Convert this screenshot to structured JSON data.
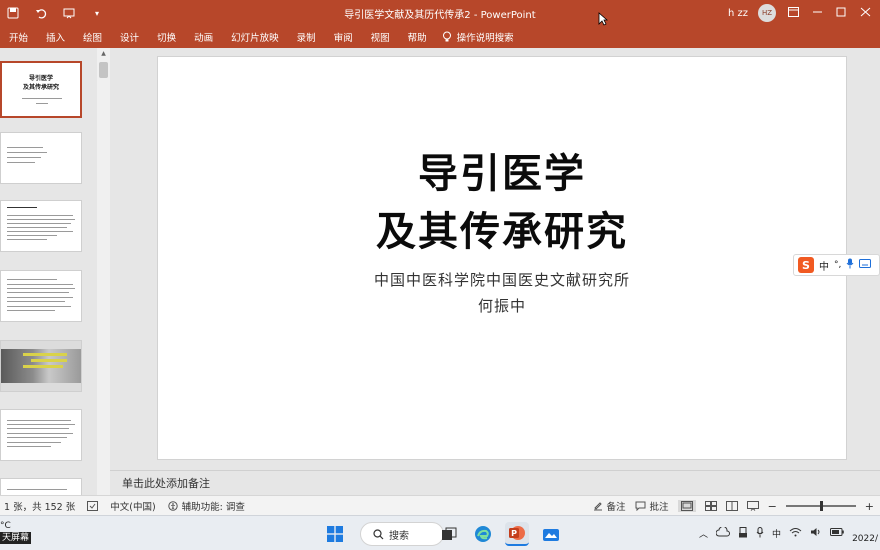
{
  "window": {
    "title": "导引医学文献及其历代传承2  -  PowerPoint",
    "user_name": "h zz",
    "user_initials": "HZ"
  },
  "ribbon": {
    "tabs": [
      "开始",
      "插入",
      "绘图",
      "设计",
      "切换",
      "动画",
      "幻灯片放映",
      "录制",
      "审阅",
      "视图",
      "帮助"
    ],
    "tell_me": "操作说明搜索"
  },
  "slide": {
    "title_line1": "导引医学",
    "title_line2": "及其传承研究",
    "subtitle_line1": "中国中医科学院中国医史文献研究所",
    "subtitle_line2": "何振中"
  },
  "thumbnails": {
    "first_title_line1": "导引医学",
    "first_title_line2": "及其传承研究"
  },
  "notes": {
    "placeholder": "单击此处添加备注"
  },
  "statusbar": {
    "slide_counter": "1 张，共 152 张",
    "language": "中文(中国)",
    "accessibility": "辅助功能: 调查",
    "notes_label": "备注",
    "comments_label": "批注"
  },
  "ime": {
    "mode": "中"
  },
  "taskbar": {
    "search_label": "搜索",
    "weather_temp": "°C",
    "weather_label": "天屏幕",
    "date": "2022/"
  },
  "colors": {
    "ppt_accent": "#b7472a",
    "ime_brand": "#f15a22"
  },
  "icons": [
    "autosave-icon",
    "undo-icon",
    "present-icon",
    "cursor-icon",
    "search-icon",
    "notes-icon",
    "comments-icon",
    "normal-view-icon",
    "sorter-view-icon",
    "reading-view-icon",
    "slideshow-icon",
    "windows-start-icon",
    "powerpoint-icon",
    "edge-icon",
    "explorer-icon",
    "wifi-icon",
    "speaker-icon",
    "battery-icon",
    "cloud-icon",
    "mic-icon"
  ]
}
